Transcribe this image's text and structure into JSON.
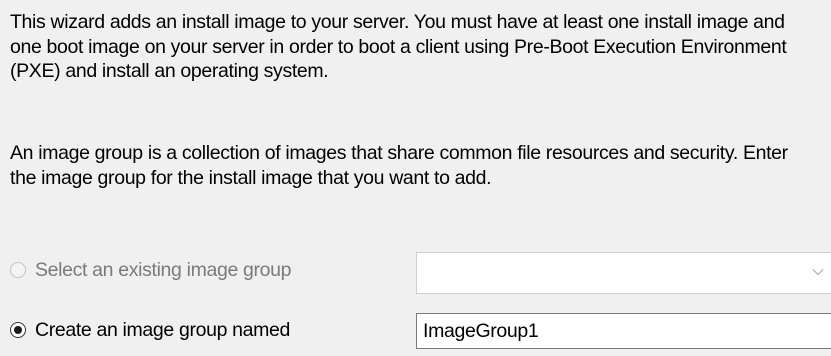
{
  "intro_text": "This wizard adds an install image to your server. You must have at least one install image and one boot image on your server in order to boot a client using Pre-Boot Execution Environment (PXE) and install an operating system.",
  "group_text": "An image group is a collection of images that share common file resources and security. Enter the image group for the install image that you want to add.",
  "options": {
    "existing": {
      "label": "Select an existing image group",
      "selected": false,
      "enabled": false,
      "combo_value": ""
    },
    "create": {
      "label": "Create an image group named",
      "selected": true,
      "enabled": true,
      "input_value": "ImageGroup1"
    }
  },
  "colors": {
    "background": "#f0f0f0",
    "disabled_text": "#7a7a7a",
    "input_border": "#7a7a7a"
  },
  "icons": {
    "combo_arrow": "chevron-down-icon"
  }
}
